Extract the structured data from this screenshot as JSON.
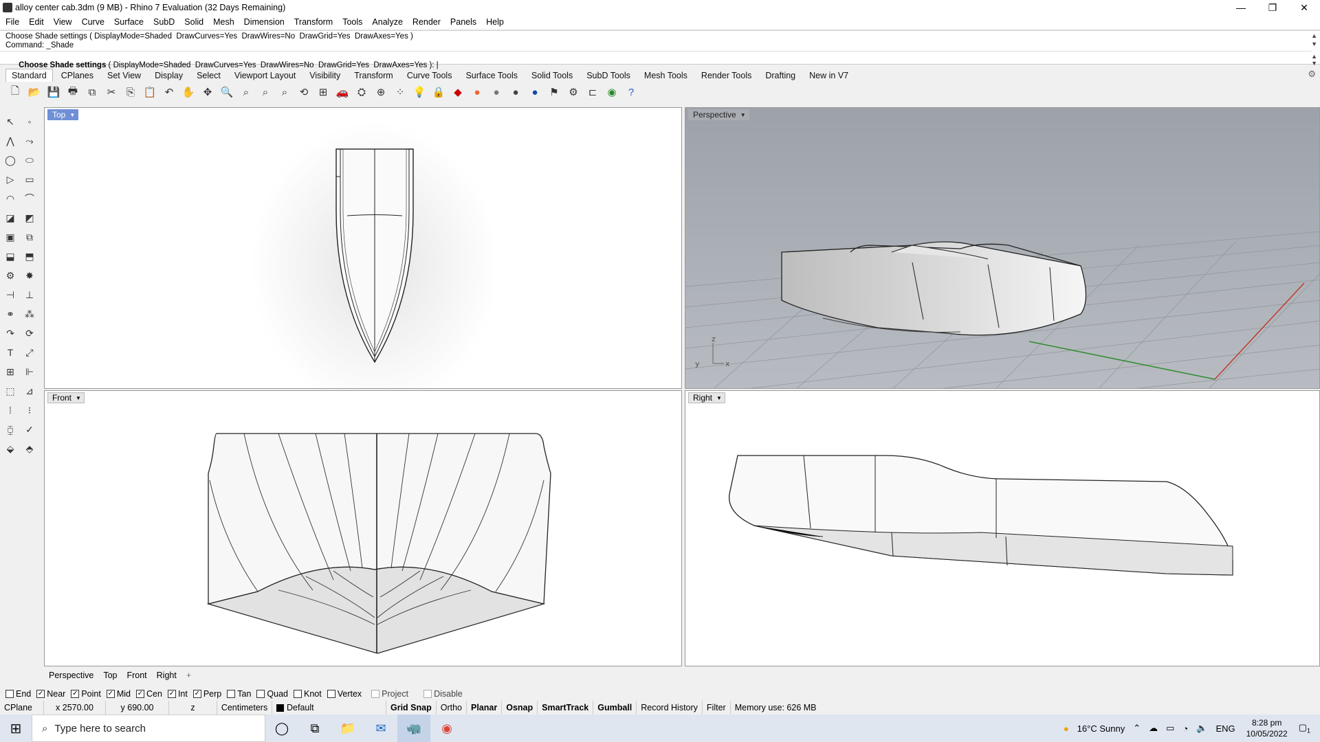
{
  "window": {
    "title": "alloy center cab.3dm (9 MB) - Rhino 7 Evaluation (32 Days Remaining)",
    "minimize": "—",
    "restore": "❐",
    "close": "✕"
  },
  "menu": [
    "File",
    "Edit",
    "View",
    "Curve",
    "Surface",
    "SubD",
    "Solid",
    "Mesh",
    "Dimension",
    "Transform",
    "Tools",
    "Analyze",
    "Render",
    "Panels",
    "Help"
  ],
  "command": {
    "history1": "Choose Shade settings ( DisplayMode=Shaded  DrawCurves=Yes  DrawWires=No  DrawGrid=Yes  DrawAxes=Yes )",
    "history2": "Command: _Shade",
    "prompt_bold": "Choose Shade settings",
    "prompt_rest": " ( DisplayMode=Shaded  DrawCurves=Yes  DrawWires=No  DrawGrid=Yes  DrawAxes=Yes ): "
  },
  "toolbar_tabs": [
    "Standard",
    "CPlanes",
    "Set View",
    "Display",
    "Select",
    "Viewport Layout",
    "Visibility",
    "Transform",
    "Curve Tools",
    "Surface Tools",
    "Solid Tools",
    "SubD Tools",
    "Mesh Tools",
    "Render Tools",
    "Drafting",
    "New in V7"
  ],
  "viewports": {
    "top": "Top",
    "perspective": "Perspective",
    "front": "Front",
    "right": "Right"
  },
  "viewport_tabs": [
    "Perspective",
    "Top",
    "Front",
    "Right",
    "+"
  ],
  "osnaps": [
    {
      "label": "End",
      "checked": false
    },
    {
      "label": "Near",
      "checked": true
    },
    {
      "label": "Point",
      "checked": true
    },
    {
      "label": "Mid",
      "checked": true
    },
    {
      "label": "Cen",
      "checked": true
    },
    {
      "label": "Int",
      "checked": true
    },
    {
      "label": "Perp",
      "checked": true
    },
    {
      "label": "Tan",
      "checked": false
    },
    {
      "label": "Quad",
      "checked": false
    },
    {
      "label": "Knot",
      "checked": false
    },
    {
      "label": "Vertex",
      "checked": false
    },
    {
      "label": "Project",
      "checked": false
    },
    {
      "label": "Disable",
      "checked": false
    }
  ],
  "status": {
    "cplane": "CPlane",
    "x": "x 2570.00",
    "y": "y 690.00",
    "z": "z",
    "units": "Centimeters",
    "layer": "Default",
    "grid_snap": "Grid Snap",
    "ortho": "Ortho",
    "planar": "Planar",
    "osnap": "Osnap",
    "smarttrack": "SmartTrack",
    "gumball": "Gumball",
    "record_history": "Record History",
    "filter": "Filter",
    "memory": "Memory use: 626 MB"
  },
  "taskbar": {
    "search_placeholder": "Type here to search",
    "weather": "16°C  Sunny",
    "lang": "ENG",
    "time": "8:28 pm",
    "date": "10/05/2022",
    "notifications": "1"
  }
}
